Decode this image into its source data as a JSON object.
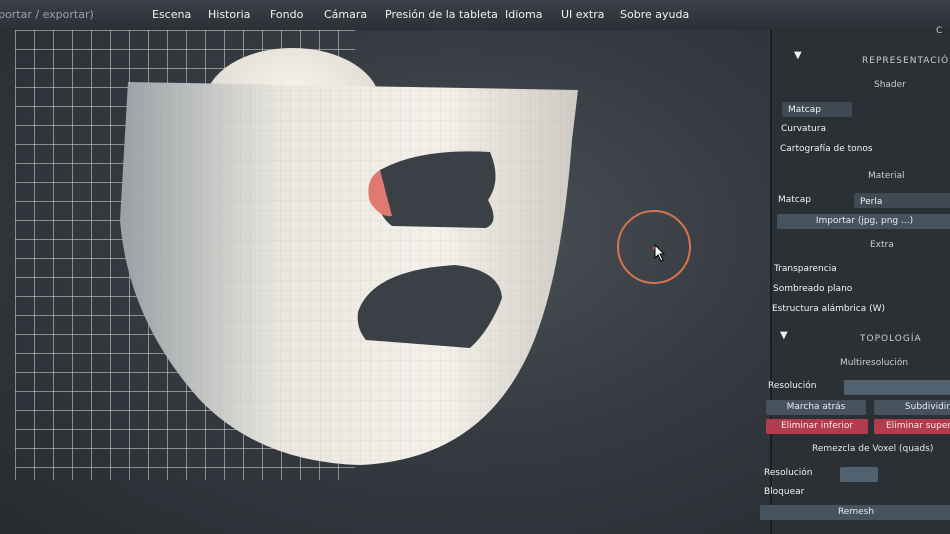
{
  "menu": [
    "(importar / exportar)",
    "Escena",
    "Historia",
    "Fondo",
    "Cámara",
    "Presión de la tableta",
    "Idioma",
    "UI extra",
    "Sobre ayuda"
  ],
  "panel": {
    "representation": {
      "header": "REPRESENTACIÓN",
      "shader_title": "Shader",
      "shaders": [
        "Matcap",
        "Curvatura",
        "Cartografía de tonos"
      ],
      "material_title": "Material",
      "matcap_label": "Matcap",
      "matcap_value": "Perla",
      "import_button": "Importar (jpg, png ...)",
      "extra_title": "Extra",
      "extra_options": [
        "Transparencia",
        "Sombreado plano",
        "Estructura alámbrica (W)"
      ]
    },
    "topology": {
      "header": "TOPOLOGÍA",
      "multires_title": "Multiresolución",
      "resolution_label": "Resolución",
      "back_button": "Marcha atrás",
      "subdivide_button": "Subdividir",
      "delete_lower_button": "Eliminar inferior",
      "delete_upper_button": "Eliminar superior",
      "voxel_title": "Remezcla de Voxel (quads)",
      "voxel_resolution_label": "Resolución",
      "lock_label": "Bloquear",
      "remesh_button": "Remesh"
    }
  },
  "colors": {
    "brush_ring": "#d9734e",
    "danger_button": "#b23b4c",
    "panel_bg": "#2b3035"
  }
}
